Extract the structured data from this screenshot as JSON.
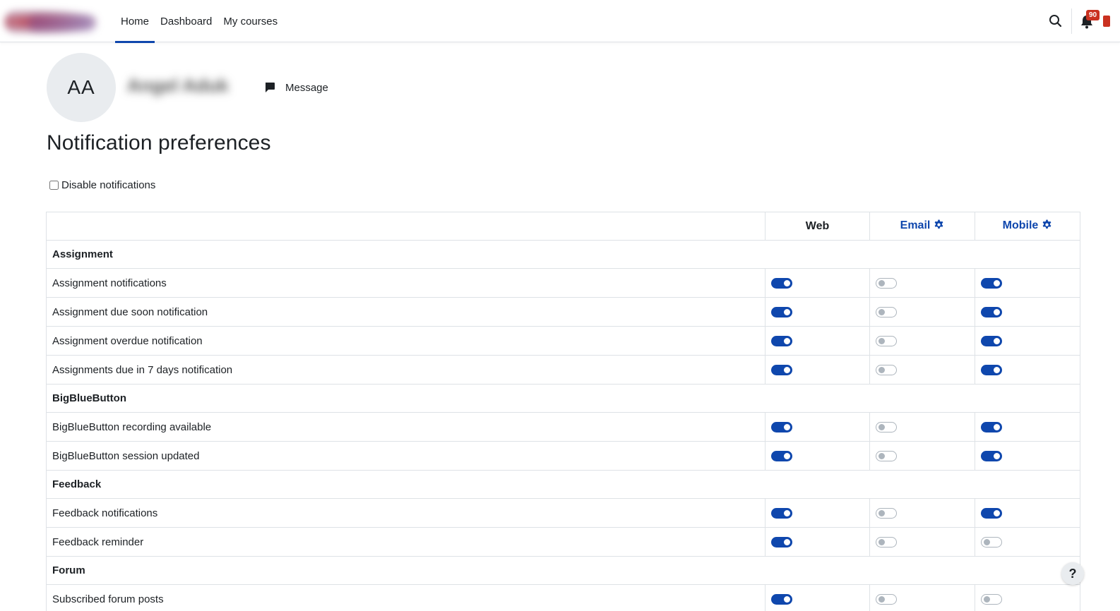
{
  "nav": {
    "items": [
      {
        "label": "Home",
        "active": true
      },
      {
        "label": "Dashboard",
        "active": false
      },
      {
        "label": "My courses",
        "active": false
      }
    ],
    "notification_count": "90"
  },
  "profile": {
    "initials": "AA",
    "name": "Angel Aduk",
    "message_label": "Message"
  },
  "page": {
    "title": "Notification preferences",
    "disable_label": "Disable notifications",
    "disable_checked": false
  },
  "table": {
    "columns": [
      {
        "label": "Web",
        "configurable": false
      },
      {
        "label": "Email",
        "configurable": true
      },
      {
        "label": "Mobile",
        "configurable": true
      }
    ],
    "groups": [
      {
        "name": "Assignment",
        "items": [
          {
            "label": "Assignment notifications",
            "web": true,
            "email": false,
            "mobile": true
          },
          {
            "label": "Assignment due soon notification",
            "web": true,
            "email": false,
            "mobile": true
          },
          {
            "label": "Assignment overdue notification",
            "web": true,
            "email": false,
            "mobile": true
          },
          {
            "label": "Assignments due in 7 days notification",
            "web": true,
            "email": false,
            "mobile": true
          }
        ]
      },
      {
        "name": "BigBlueButton",
        "items": [
          {
            "label": "BigBlueButton recording available",
            "web": true,
            "email": false,
            "mobile": true
          },
          {
            "label": "BigBlueButton session updated",
            "web": true,
            "email": false,
            "mobile": true
          }
        ]
      },
      {
        "name": "Feedback",
        "items": [
          {
            "label": "Feedback notifications",
            "web": true,
            "email": false,
            "mobile": true
          },
          {
            "label": "Feedback reminder",
            "web": true,
            "email": false,
            "mobile": false
          }
        ]
      },
      {
        "name": "Forum",
        "items": [
          {
            "label": "Subscribed forum posts",
            "web": true,
            "email": false,
            "mobile": false
          }
        ]
      }
    ]
  },
  "help": {
    "label": "?"
  },
  "colors": {
    "accent": "#0f47ad",
    "badge": "#ca3120",
    "border": "#dee2e6",
    "text": "#1d2125"
  }
}
